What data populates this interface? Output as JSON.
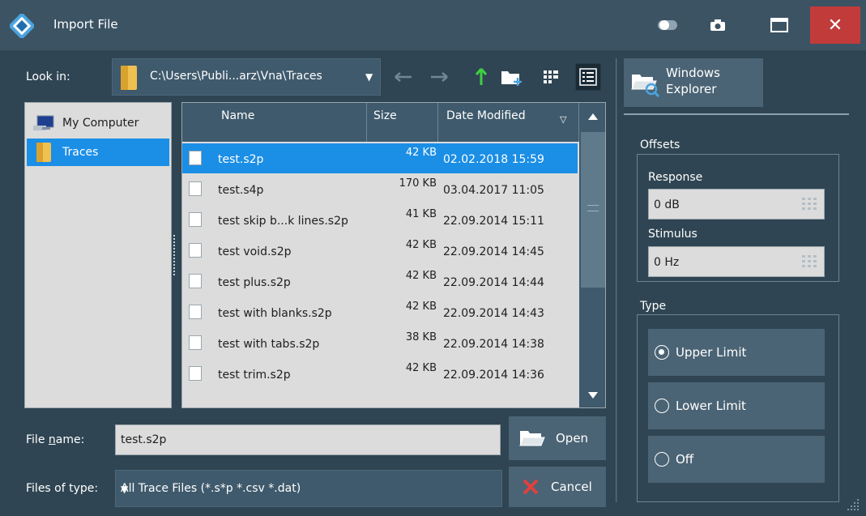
{
  "window": {
    "title": "Import File",
    "close_label": "✕"
  },
  "lookin": {
    "label": "Look in:",
    "path": "C:\\Users\\Publi...arz\\Vna\\Traces"
  },
  "toolbar": {
    "back_icon": "arrow-left-icon",
    "forward_icon": "arrow-right-icon",
    "up_icon": "arrow-up-icon",
    "new_folder_icon": "new-folder-icon",
    "list_view_icon": "list-view-icon",
    "detail_view_icon": "detail-view-icon"
  },
  "sidebar": {
    "items": [
      {
        "label": "My Computer",
        "icon": "computer-icon",
        "selected": false
      },
      {
        "label": "Traces",
        "icon": "folder-icon",
        "selected": true
      }
    ]
  },
  "files": {
    "columns": {
      "name": "Name",
      "size": "Size",
      "date": "Date Modified"
    },
    "rows": [
      {
        "name": "test.s2p",
        "size": "42 KB",
        "date": "02.02.2018 15:59",
        "selected": true
      },
      {
        "name": "test.s4p",
        "size": "170 KB",
        "date": "03.04.2017 11:05",
        "selected": false
      },
      {
        "name": "test skip b...k lines.s2p",
        "size": "41 KB",
        "date": "22.09.2014 15:11",
        "selected": false
      },
      {
        "name": "test void.s2p",
        "size": "42 KB",
        "date": "22.09.2014 14:45",
        "selected": false
      },
      {
        "name": "test plus.s2p",
        "size": "42 KB",
        "date": "22.09.2014 14:44",
        "selected": false
      },
      {
        "name": "test with blanks.s2p",
        "size": "42 KB",
        "date": "22.09.2014 14:43",
        "selected": false
      },
      {
        "name": "test with tabs.s2p",
        "size": "38 KB",
        "date": "22.09.2014 14:38",
        "selected": false
      },
      {
        "name": "test trim.s2p",
        "size": "42 KB",
        "date": "22.09.2014 14:36",
        "selected": false
      }
    ]
  },
  "filename": {
    "label_prefix": "File ",
    "label_underlined": "n",
    "label_suffix": "ame:",
    "value": "test.s2p"
  },
  "filetype": {
    "label": "Files of type:",
    "value": "All Trace Files (*.s*p *.csv *.dat)"
  },
  "buttons": {
    "open": "Open",
    "cancel": "Cancel",
    "explorer_line1": "Windows",
    "explorer_line2": "Explorer"
  },
  "offsets": {
    "title": "Offsets",
    "response_label": "Response",
    "response_value": "0 dB",
    "stimulus_label": "Stimulus",
    "stimulus_value": "0 Hz"
  },
  "type": {
    "title": "Type",
    "options": [
      {
        "label": "Upper Limit",
        "selected": true
      },
      {
        "label": "Lower Limit",
        "selected": false
      },
      {
        "label": "Off",
        "selected": false
      }
    ]
  },
  "colors": {
    "background": "#2f4553",
    "panel": "#3f5a6c",
    "selection": "#1b8ee6",
    "close": "#c13b3b",
    "up_arrow": "#3fd13f"
  }
}
